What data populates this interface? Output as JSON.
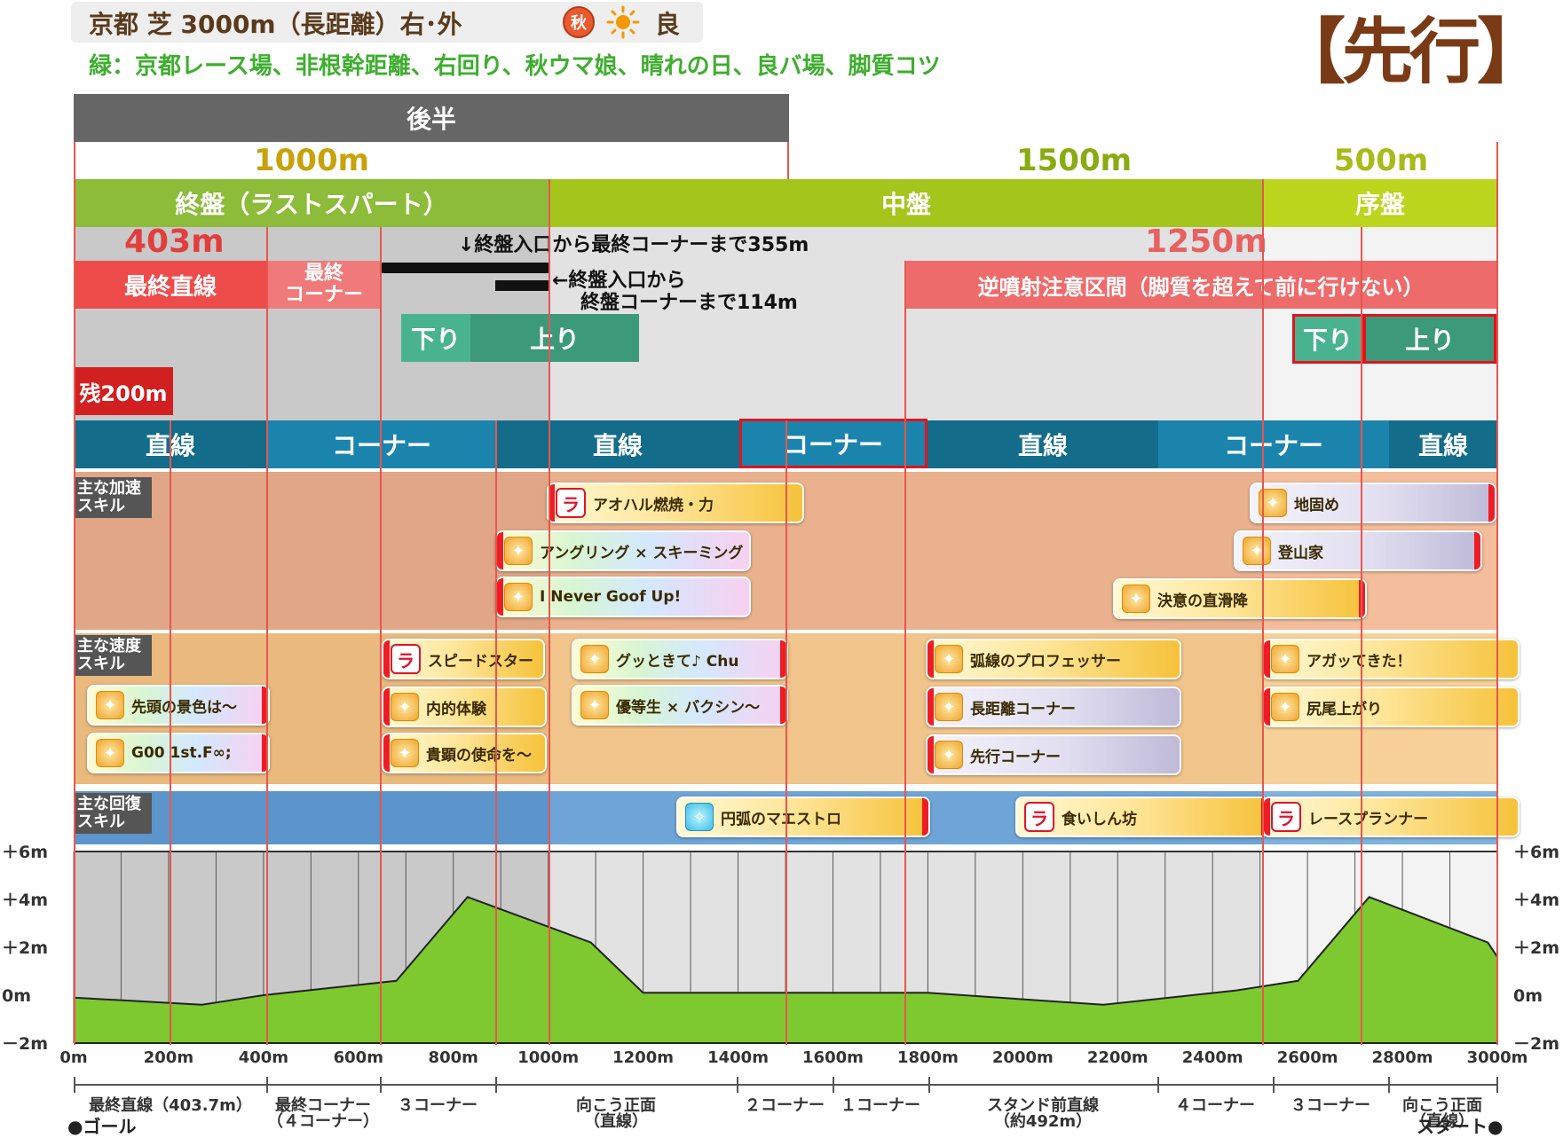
{
  "header": {
    "title": "京都 芝 3000m（長距離）右･外",
    "badge_season": "秋",
    "badge_ground": "良",
    "subtitle": "緑：京都レース場、非根幹距離、右回り、秋ウマ娘、晴れの日、良バ場、脚質コツ",
    "style": "【先行】"
  },
  "phases": {
    "second_half": "後半",
    "distance_final": "1000m",
    "distance_middle": "1500m",
    "distance_opening": "500m",
    "final_leg": "終盤（ラストスパート）",
    "middle_leg": "中盤",
    "opening_leg": "序盤"
  },
  "annotations": {
    "len_403": "403m",
    "len_1250": "1250m",
    "note_355": "↓終盤入口から最終コーナーまで355m",
    "note_114_line1": "←終盤入口から",
    "note_114_line2": "終盤コーナーまで114m",
    "final_straight": "最終直線",
    "final_corner_line1": "最終",
    "final_corner_line2": "コーナー",
    "reverse_zone": "逆噴射注意区間（脚質を超えて前に行けない）",
    "remaining_200": "残200m",
    "down": "下り",
    "up": "上り"
  },
  "segments": [
    "直線",
    "コーナー",
    "直線",
    "コーナー",
    "直線",
    "コーナー",
    "直線"
  ],
  "skill_rows": {
    "accel_label": "主な加速\nスキル",
    "speed_label": "主な速度\nスキル",
    "recovery_label": "主な回復\nスキル"
  },
  "skills": {
    "accel": [
      "アオハル燃焼・力",
      "アングリング × スキーミング",
      "I Never Goof Up!",
      "地固め",
      "登山家",
      "決意の直滑降"
    ],
    "speed": [
      "スピードスター",
      "内的体験",
      "貴顕の使命を～",
      "先頭の景色は～",
      "G00 1st.F∞;",
      "グッときて♪ Chu",
      "優等生 × バクシン～",
      "弧線のプロフェッサー",
      "長距離コーナー",
      "先行コーナー",
      "アガッてきた！",
      "尻尾上がり"
    ],
    "recovery": [
      "円弧のマエストロ",
      "食いしん坊",
      "レースプランナー"
    ]
  },
  "chart_data": {
    "type": "area",
    "title": "",
    "xlabel": "",
    "ylabel": "",
    "x_ticks": [
      "0m",
      "200m",
      "400m",
      "600m",
      "800m",
      "1000m",
      "1200m",
      "1400m",
      "1600m",
      "1800m",
      "2000m",
      "2200m",
      "2400m",
      "2600m",
      "2800m",
      "3000m"
    ],
    "y_ticks": [
      "＋6m",
      "＋4m",
      "＋2m",
      "0m",
      "－2m"
    ],
    "xlim": [
      0,
      3000
    ],
    "ylim": [
      -2,
      6
    ],
    "series": [
      {
        "values": [
          {
            "x": 0,
            "y": -0.1
          },
          {
            "x": 270,
            "y": -0.4
          },
          {
            "x": 400,
            "y": 0
          },
          {
            "x": 680,
            "y": 0.6
          },
          {
            "x": 830,
            "y": 4.1
          },
          {
            "x": 1090,
            "y": 2.2
          },
          {
            "x": 1200,
            "y": 0.1
          },
          {
            "x": 1800,
            "y": 0.1
          },
          {
            "x": 2170,
            "y": -0.4
          },
          {
            "x": 2450,
            "y": 0.2
          },
          {
            "x": 2580,
            "y": 0.6
          },
          {
            "x": 2730,
            "y": 4.1
          },
          {
            "x": 2980,
            "y": 2.2
          },
          {
            "x": 3000,
            "y": 1.6
          }
        ]
      }
    ]
  },
  "track_sections": [
    "最終直線（403.7m）",
    "最終コーナー\n（４コーナー）",
    "３コーナー",
    "向こう正面\n（直線）",
    "２コーナー",
    "１コーナー",
    "スタンド前直線\n（約492m）",
    "４コーナー",
    "３コーナー",
    "向こう正面\n（直線）"
  ],
  "goal": "●ゴール",
  "start": "スタート●"
}
